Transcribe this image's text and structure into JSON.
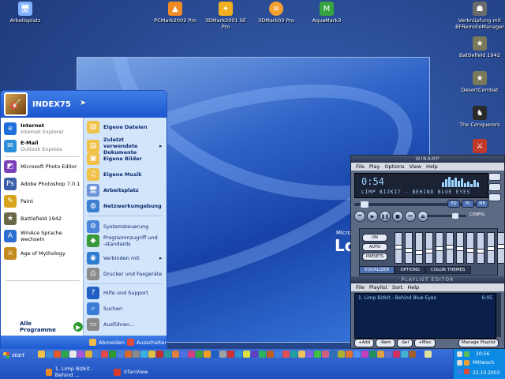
{
  "desktop": {
    "icons": [
      {
        "name": "arbeitsplatz",
        "label": "Arbeitsplatz",
        "icon": "computer-icon",
        "color": "#7fb2ff"
      },
      {
        "name": "pcmark2002",
        "label": "PCMark2002 Pro",
        "icon": "pcmark-icon",
        "color": "#f08a24"
      },
      {
        "name": "3dmark2001",
        "label": "3DMark2001 SE Pro",
        "icon": "3dmark-icon",
        "color": "#f0b020"
      },
      {
        "name": "3dmark03",
        "label": "3DMark03 Pro",
        "icon": "3dmark03-icon",
        "color": "#f4a030"
      },
      {
        "name": "aquamark",
        "label": "AquaMark3",
        "icon": "aquamark-icon",
        "color": "#36a33e"
      },
      {
        "name": "bfremote",
        "label": "Verknüpfung mit BFRemoteManager",
        "icon": "bfremote-icon",
        "color": "#6b6b6b"
      },
      {
        "name": "battlefield",
        "label": "Battlefield 1942",
        "icon": "battlefield-icon",
        "color": "#7a7a5a"
      },
      {
        "name": "desertcombat",
        "label": "DesertCombat",
        "icon": "desertcombat-icon",
        "color": "#7a7a5a"
      },
      {
        "name": "conquerors",
        "label": "The Conquerors",
        "icon": "conquerors-icon",
        "color": "#2a2a2a"
      },
      {
        "name": "aoe",
        "label": "",
        "icon": "aoe-icon",
        "color": "#c0392b"
      }
    ]
  },
  "wallpaper": {
    "brand_small": "Microsoft",
    "brand_big": "Lon"
  },
  "start_menu": {
    "user": "INDEX75",
    "pinned": [
      {
        "title": "Internet",
        "subtitle": "Internet Explorer",
        "icon": "internet-explorer-icon",
        "color": "#1e6fd9"
      },
      {
        "title": "E-Mail",
        "subtitle": "Outlook Express",
        "icon": "outlook-icon",
        "color": "#2d8fd9"
      }
    ],
    "recent": [
      {
        "label": "Microsoft Photo Editor",
        "icon": "photo-editor-icon",
        "color": "#7b3fb8"
      },
      {
        "label": "Adobe Photoshop 7.0.1",
        "icon": "photoshop-icon",
        "color": "#3b5ea8"
      },
      {
        "label": "Paint",
        "icon": "paint-icon",
        "color": "#d6a41c"
      },
      {
        "label": "Battlefield 1942",
        "icon": "battlefield-icon",
        "color": "#6a6a4a"
      },
      {
        "label": "WinAce Sprache wechseln",
        "icon": "winace-icon",
        "color": "#2f6fd1"
      },
      {
        "label": "Age of Mythology",
        "icon": "aom-icon",
        "color": "#c48a1e"
      }
    ],
    "all_programs": "Alle Programme",
    "right": [
      {
        "label": "Eigene Dateien",
        "icon": "my-documents-icon",
        "color": "#f1c24a",
        "bold": true
      },
      {
        "label": "Zuletzt verwendete Dokumente",
        "icon": "recent-docs-icon",
        "color": "#f1c24a",
        "bold": true,
        "arrow": "▸"
      },
      {
        "label": "Eigene Bilder",
        "icon": "my-pictures-icon",
        "color": "#f1c24a",
        "bold": true
      },
      {
        "label": "Eigene Musik",
        "icon": "my-music-icon",
        "color": "#f1c24a",
        "bold": true
      },
      {
        "label": "Arbeitsplatz",
        "icon": "my-computer-icon",
        "color": "#6a93d8",
        "bold": true
      },
      {
        "label": "Netzwerkumgebung",
        "icon": "network-icon",
        "color": "#3c7fd1",
        "bold": true
      },
      {
        "label": "Systemsteuerung",
        "icon": "control-panel-icon",
        "color": "#4b84d8",
        "bold": false
      },
      {
        "label": "Programmzugriff und -standards",
        "icon": "program-access-icon",
        "color": "#3a9a3a",
        "bold": false
      },
      {
        "label": "Verbinden mit",
        "icon": "connect-icon",
        "color": "#2e7bd2",
        "bold": false,
        "arrow": "▸"
      },
      {
        "label": "Drucker und Faxgeräte",
        "icon": "printer-icon",
        "color": "#8a8a8a",
        "bold": false
      },
      {
        "label": "Hilfe und Support",
        "icon": "help-icon",
        "color": "#1f5fc4",
        "bold": false
      },
      {
        "label": "Suchen",
        "icon": "search-icon",
        "color": "#3a7bd8",
        "bold": false
      },
      {
        "label": "Ausführen...",
        "icon": "run-icon",
        "color": "#8a8a8a",
        "bold": false
      }
    ],
    "footer": {
      "logoff": "Abmelden",
      "shutdown": "Ausschalten"
    }
  },
  "winamp": {
    "title": "WINAMP",
    "menu": [
      "File",
      "Play",
      "Options",
      "View",
      "Help"
    ],
    "time": "0:54",
    "song": "LIMP BIZKIT - BEHIND BLUE EYES",
    "mode_buttons": [
      "EQ",
      "PL",
      "MB"
    ],
    "config_label": "CONFIG",
    "eq_buttons": [
      "ON",
      "AUTO",
      "PRESETS"
    ],
    "eq_bands": [
      0.55,
      0.45,
      0.35,
      0.4,
      0.5,
      0.55,
      0.5,
      0.45,
      0.4,
      0.5,
      0.6
    ],
    "volume": 0.75,
    "seek": 0.05,
    "tabs": [
      "EQUALIZER",
      "OPTIONS",
      "COLOR THEMES"
    ],
    "playlist": {
      "title": "PLAYLIST EDITOR",
      "menu": [
        "File",
        "Playlist",
        "Sort",
        "Help"
      ],
      "items": [
        {
          "text": "1. Limp Bizkit - Behind Blue Eyes",
          "length": "6:05"
        }
      ],
      "buttons": [
        "+Add",
        "-Rem",
        "-Sel",
        "+Misc"
      ],
      "manage": "Manage Playlist"
    }
  },
  "taskbar": {
    "start_label": "start",
    "tasks": [
      {
        "label": "1. Limp Bizkit - Behind ...",
        "icon": "winamp-icon",
        "color": "#f08a24"
      },
      {
        "label": "IrfanView",
        "icon": "irfanview-icon",
        "color": "#d63a2a"
      }
    ],
    "quicklaunch_colors": [
      "#f2c24a",
      "#3b8bd8",
      "#e35a2a",
      "#2fa84a",
      "#e8e8e8",
      "#a855d8",
      "#d8b23a",
      "#3a7bd8",
      "#e24a4a",
      "#2d9a2d",
      "#4a7fd8",
      "#d86a2a",
      "#8a8a8a",
      "#3ab0e0",
      "#e0c040",
      "#c03030",
      "#2a9aa0",
      "#e08040",
      "#5070e0",
      "#d04080",
      "#40a040",
      "#f0a020",
      "#2060c0",
      "#a0a0a0",
      "#d03030",
      "#3090d0",
      "#e0e040",
      "#6040c0",
      "#30b060",
      "#c06020",
      "#4080e0",
      "#e05050",
      "#20a0a0",
      "#f0c060",
      "#8060e0",
      "#40c040",
      "#d06080",
      "#3070b0",
      "#b0b030",
      "#e07030",
      "#5090f0",
      "#c040c0",
      "#209060",
      "#e0a040",
      "#6070d0",
      "#d03060",
      "#40b0d0",
      "#a06030",
      "#3060e0",
      "#e0e0a0"
    ],
    "tray": {
      "time": "20:56",
      "day": "Mittwoch",
      "date": "22.10.2003"
    }
  }
}
